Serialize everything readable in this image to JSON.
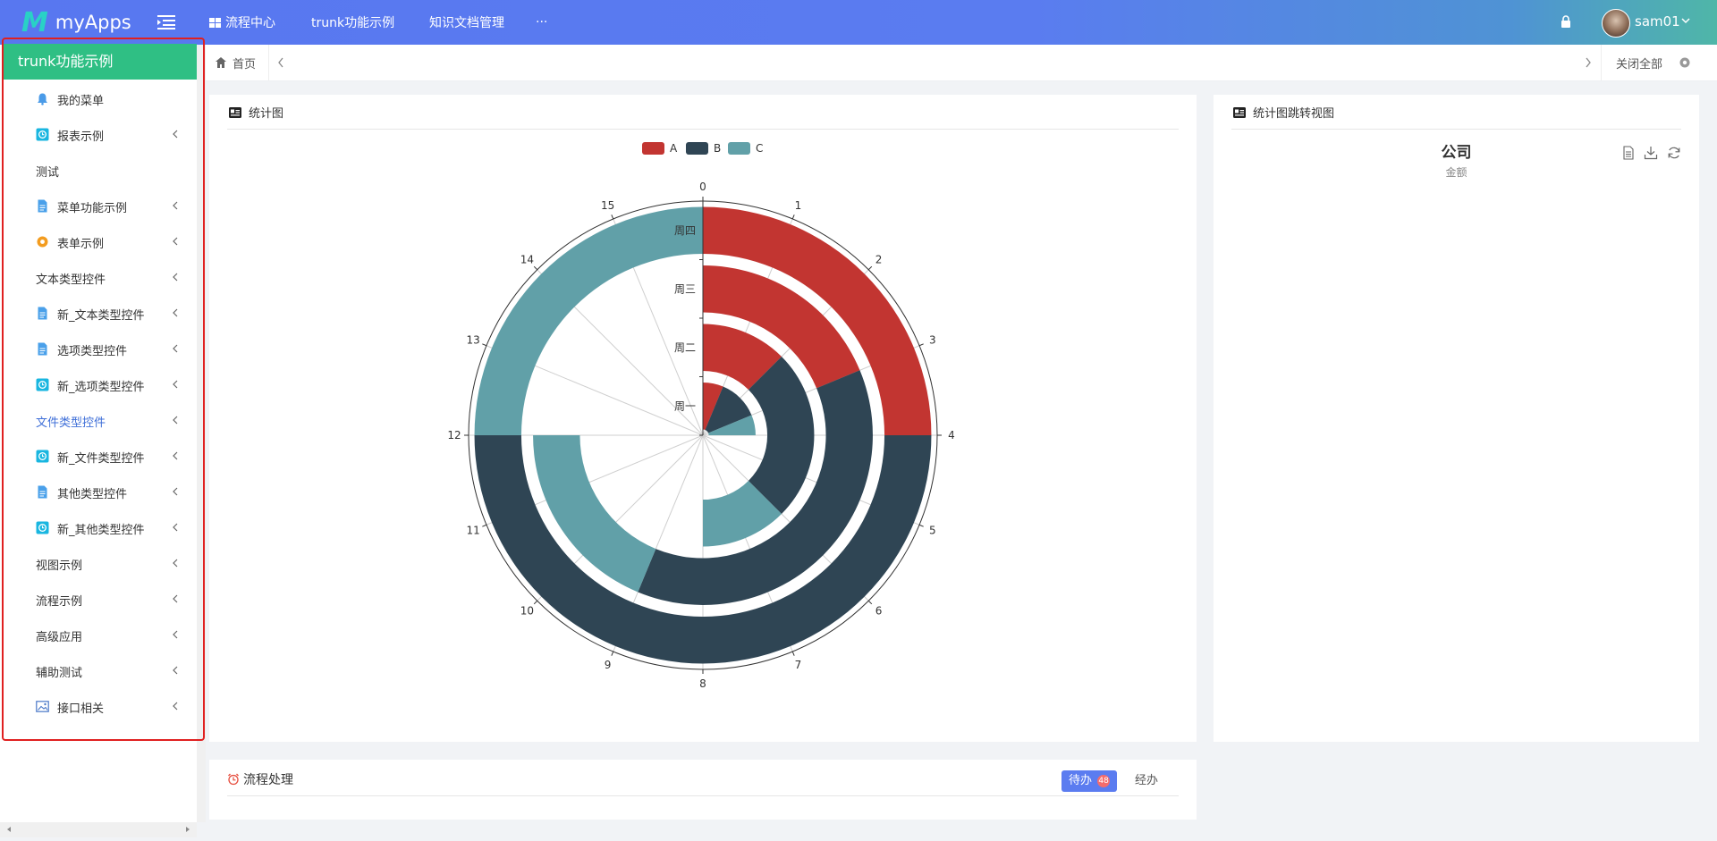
{
  "app": {
    "name": "myApps",
    "logo_letter": "M"
  },
  "topnav": [
    {
      "label": "流程中心",
      "icon": "grid-icon"
    },
    {
      "label": "trunk功能示例"
    },
    {
      "label": "知识文档管理"
    },
    {
      "label": "···"
    }
  ],
  "user": {
    "name": "sam01"
  },
  "sidebar": {
    "title": "trunk功能示例",
    "items": [
      {
        "label": "我的菜单",
        "icon": "bell-icon",
        "arrow": false
      },
      {
        "label": "报表示例",
        "icon": "report-icon",
        "arrow": true
      },
      {
        "label": "测试",
        "icon": "",
        "arrow": false
      },
      {
        "label": "菜单功能示例",
        "icon": "document-icon",
        "arrow": true
      },
      {
        "label": "表单示例",
        "icon": "gear-icon",
        "arrow": true
      },
      {
        "label": "文本类型控件",
        "icon": "",
        "arrow": true
      },
      {
        "label": "新_文本类型控件",
        "icon": "document-icon",
        "arrow": true
      },
      {
        "label": "选项类型控件",
        "icon": "document-icon",
        "arrow": true
      },
      {
        "label": "新_选项类型控件",
        "icon": "report-icon",
        "arrow": true
      },
      {
        "label": "文件类型控件",
        "icon": "",
        "arrow": true,
        "active": true
      },
      {
        "label": "新_文件类型控件",
        "icon": "report-icon",
        "arrow": true
      },
      {
        "label": "其他类型控件",
        "icon": "document-icon",
        "arrow": true
      },
      {
        "label": "新_其他类型控件",
        "icon": "report-icon",
        "arrow": true
      },
      {
        "label": "视图示例",
        "icon": "",
        "arrow": true
      },
      {
        "label": "流程示例",
        "icon": "",
        "arrow": true
      },
      {
        "label": "高级应用",
        "icon": "",
        "arrow": true
      },
      {
        "label": "辅助测试",
        "icon": "",
        "arrow": true
      },
      {
        "label": "接口相关",
        "icon": "image-icon",
        "arrow": true
      }
    ]
  },
  "breadcrumb": {
    "home": "首页",
    "close_all": "关闭全部"
  },
  "chart_panel": {
    "title": "统计图"
  },
  "right_panel": {
    "title": "统计图跳转视图",
    "chart_title": "公司",
    "chart_subtitle": "金额"
  },
  "flow_panel": {
    "title": "流程处理",
    "tab_todo": "待办",
    "todo_count": "48",
    "tab_done": "经办"
  },
  "colors": {
    "A": "#c23531",
    "B": "#2f4554",
    "C": "#61a0a8",
    "accent": "#5b7cf0",
    "sidebar_head": "#2fbf84"
  },
  "chart_data": {
    "type": "polar-bar",
    "legend": [
      "A",
      "B",
      "C"
    ],
    "angle_axis": {
      "min": 0,
      "max": 16,
      "ticks": [
        "0",
        "1",
        "2",
        "3",
        "4",
        "5",
        "6",
        "7",
        "8",
        "9",
        "10",
        "11",
        "12",
        "13",
        "14",
        "15"
      ]
    },
    "radius_axis": {
      "categories": [
        "周一",
        "周二",
        "周三",
        "周四"
      ]
    },
    "stacked": true,
    "series": [
      {
        "name": "A",
        "values": [
          1,
          2,
          3,
          4
        ]
      },
      {
        "name": "B",
        "values": [
          2,
          4,
          6,
          8
        ]
      },
      {
        "name": "C",
        "values": [
          1,
          2,
          3,
          4
        ]
      }
    ]
  }
}
